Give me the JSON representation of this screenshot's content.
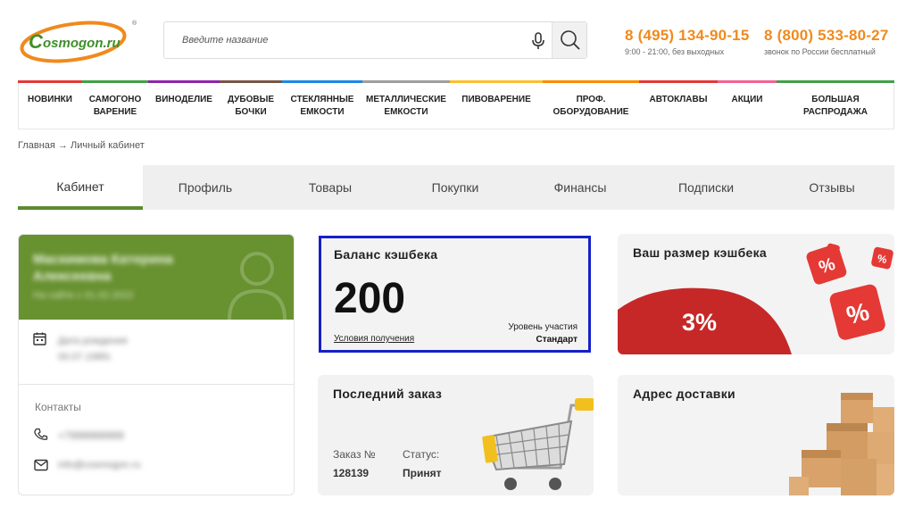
{
  "header": {
    "logo_text": "Cosmogon.ru",
    "search_placeholder": "Введите название",
    "phones": [
      {
        "number": "8 (495) 134-90-15",
        "note": "9:00 - 21:00, без выходных"
      },
      {
        "number": "8 (800) 533-80-27",
        "note": "звонок по России бесплатный"
      }
    ]
  },
  "categories": [
    {
      "label": "НОВИНКИ",
      "color": "#e53935"
    },
    {
      "label": "САМОГОНО\nВАРЕНИЕ",
      "color": "#43a047"
    },
    {
      "label": "ВИНОДЕЛИЕ",
      "color": "#8e24aa"
    },
    {
      "label": "ДУБОВЫЕ\nБОЧКИ",
      "color": "#795548"
    },
    {
      "label": "СТЕКЛЯННЫЕ\nЕМКОСТИ",
      "color": "#1e88e5"
    },
    {
      "label": "МЕТАЛЛИЧЕСКИЕ\nЕМКОСТИ",
      "color": "#9e9e9e"
    },
    {
      "label": "ПИВОВАРЕНИЕ",
      "color": "#fbc02d"
    },
    {
      "label": "ПРОФ.\nОБОРУДОВАНИЕ",
      "color": "#fb8c00"
    },
    {
      "label": "АВТОКЛАВЫ",
      "color": "#e53935"
    },
    {
      "label": "АКЦИИ",
      "color": "#f06292"
    },
    {
      "label": "БОЛЬШАЯ\nРАСПРОДАЖА",
      "color": "#43a047"
    }
  ],
  "breadcrumb": "Главная → Личный кабинет",
  "tabs": [
    {
      "label": "Кабинет",
      "active": true
    },
    {
      "label": "Профиль"
    },
    {
      "label": "Товары"
    },
    {
      "label": "Покупки"
    },
    {
      "label": "Финансы"
    },
    {
      "label": "Подписки"
    },
    {
      "label": "Отзывы"
    }
  ],
  "profile": {
    "name_line1": "Маскимова Катерина",
    "name_line2": "Алексеевна",
    "since": "На сайте с 01.02.2022",
    "birthday_label": "Дата рождения",
    "birthday_value": "00.07.1985г.",
    "contacts_title": "Контакты",
    "phone": "+7999999999",
    "email": "info@cosmogon.ru"
  },
  "cashback_balance": {
    "title": "Баланс кэшбека",
    "value": "200",
    "conditions_link": "Условия получения",
    "level_label": "Уровень участия",
    "level_value": "Стандарт"
  },
  "cashback_size": {
    "title": "Ваш размер кэшбека",
    "percent": "3%"
  },
  "last_order": {
    "title": "Последний заказ",
    "order_label": "Заказ №",
    "order_number": "128139",
    "status_label": "Статус:",
    "status_value": "Принят"
  },
  "delivery": {
    "title": "Адрес доставки"
  },
  "colors": {
    "accent_orange": "#f08a1c",
    "brand_green": "#5c8b2f",
    "profile_green": "#689130",
    "highlight_blue": "#1520c8",
    "promo_red": "#c62828"
  }
}
